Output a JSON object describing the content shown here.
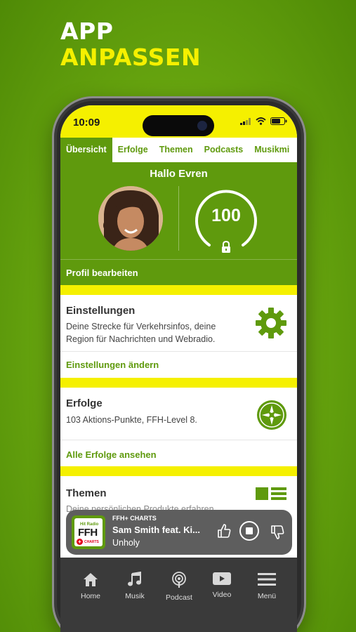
{
  "headline": {
    "line1": "APP",
    "line2": "ANPASSEN"
  },
  "status_bar": {
    "time": "10:09"
  },
  "tabs": [
    {
      "label": "Übersicht",
      "active": true
    },
    {
      "label": "Erfolge"
    },
    {
      "label": "Themen"
    },
    {
      "label": "Podcasts"
    },
    {
      "label": "Musikmi"
    }
  ],
  "profile": {
    "greeting": "Hallo Evren",
    "level": "100",
    "edit_link": "Profil bearbeiten"
  },
  "cards": {
    "einstellungen": {
      "title": "Einstellungen",
      "description": "Deine Strecke für Verkehrsinfos, deine Region für Nachrichten und Webradio.",
      "link": "Einstellungen ändern",
      "icon": "gear-icon"
    },
    "erfolge": {
      "title": "Erfolge",
      "description": "103 Aktions-Punkte, FFH-Level 8.",
      "link": "Alle Erfolge ansehen",
      "icon": "compass-star-icon"
    },
    "themen": {
      "title": "Themen",
      "description": "Deine persönlichen Produkte erfahren",
      "icon": "list-icon"
    }
  },
  "player": {
    "logo": {
      "top": "Hit Radio",
      "main": "FFH",
      "sub": "CHARTS"
    },
    "station": "FFH+ CHARTS",
    "artist": "Sam Smith feat. Ki...",
    "song": "Unholy"
  },
  "bottom_nav": [
    {
      "label": "Home",
      "icon": "home-icon"
    },
    {
      "label": "Musik",
      "icon": "music-note-icon"
    },
    {
      "label": "Podcast",
      "icon": "podcast-icon"
    },
    {
      "label": "Video",
      "icon": "video-icon"
    },
    {
      "label": "Menü",
      "icon": "menu-icon"
    }
  ],
  "colors": {
    "brand_green": "#5f9a0d",
    "brand_yellow": "#f5f000",
    "background_green": "#6aa810",
    "player_gray": "#5e5e5e",
    "nav_dark": "#3a3a3a"
  }
}
